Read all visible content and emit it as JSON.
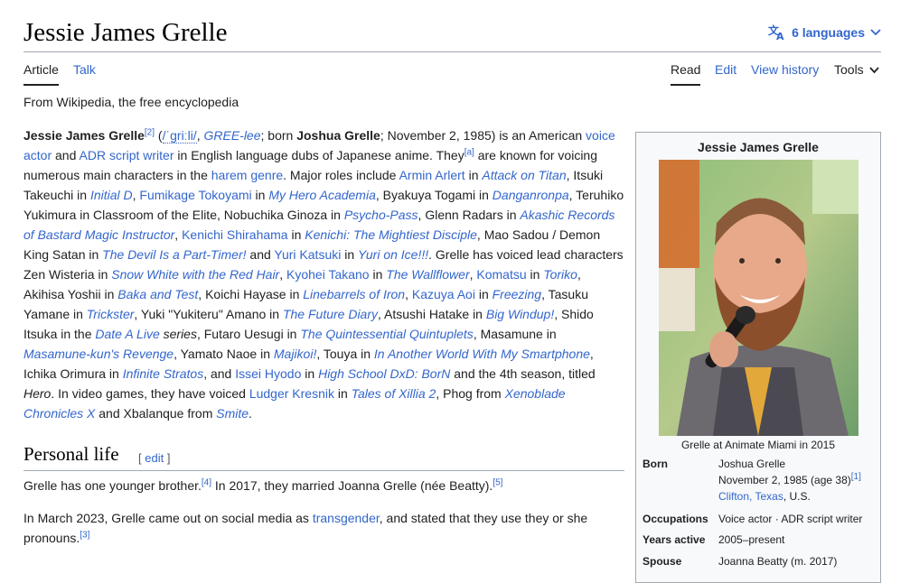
{
  "header": {
    "title": "Jessie James Grelle",
    "languages_label": "6 languages"
  },
  "tabs": {
    "article": "Article",
    "talk": "Talk",
    "read": "Read",
    "edit": "Edit",
    "view_history": "View history",
    "tools": "Tools"
  },
  "tagline": "From Wikipedia, the free encyclopedia",
  "intro": {
    "name_bold": "Jessie James Grelle",
    "ref_2": "[2]",
    "ipa": "/ˈɡriːli/",
    "respell": "GREE-lee",
    "born_text": "; born ",
    "birth_name": "Joshua Grelle",
    "after_birth": "; November 2, 1985) is an American ",
    "voice_actor": "voice actor",
    "and": " and ",
    "adr": "ADR script writer",
    "in_english": " in English language dubs of Japanese anime. They",
    "ref_a": "[a]",
    "known_for": " are known for voicing numerous main characters in the ",
    "harem": "harem genre",
    "major_roles": ". Major roles include ",
    "armin": "Armin Arlert",
    "in1": " in ",
    "aot": "Attack on Titan",
    "itsuki": ", Itsuki Takeuchi in ",
    "initial_d": "Initial D",
    "c1": ", ",
    "fumikage": "Fumikage Tokoyami",
    "in2": " in ",
    "mha": "My Hero Academia",
    "byakuya": ", Byakuya Togami in ",
    "danganronpa": "Danganronpa",
    "teruhiko": ", Teruhiko Yukimura in Classroom of the Elite, Nobuchika Ginoza in ",
    "psycho_pass": "Psycho-Pass",
    "glenn": ", Glenn Radars in ",
    "akashic": "Akashic Records of Bastard Magic Instructor",
    "c2": ", ",
    "kenichi": "Kenichi Shirahama",
    "in3": " in ",
    "kenichi_show": "Kenichi: The Mightiest Disciple",
    "mao": ", Mao Sadou / Demon King Satan in ",
    "devil": "The Devil Is a Part-Timer!",
    "and2": " and ",
    "yuri": "Yuri Katsuki",
    "in4": " in ",
    "yuri_show": "Yuri on Ice!!!",
    "lead": ". Grelle has voiced lead characters Zen Wisteria in ",
    "snow_white": "Snow White with the Red Hair",
    "c3": ", ",
    "kyohei": "Kyohei Takano",
    "in5": " in ",
    "wallflower": "The Wallflower",
    "c4": ", ",
    "komatsu": "Komatsu",
    "in6": " in ",
    "toriko": "Toriko",
    "akihisa": ", Akihisa Yoshii in ",
    "baka": "Baka and Test",
    "koichi": ", Koichi Hayase in ",
    "linebarrels": "Linebarrels of Iron",
    "c5": ", ",
    "kazuya": "Kazuya Aoi",
    "in7": " in ",
    "freezing": "Freezing",
    "tasuku": ", Tasuku Yamane in ",
    "trickster": "Trickster",
    "yukiteru": ", Yuki \"Yukiteru\" Amano in ",
    "future_diary": "The Future Diary",
    "atsushi": ", Atsushi Hatake in ",
    "big_windup": "Big Windup!",
    "shido": ", Shido Itsuka in the ",
    "date_a_live": "Date A Live",
    "series": " series",
    "futaro": ", Futaro Uesugi in ",
    "quint": "The Quintessential Quintuplets",
    "masamune_pre": ", Masamune in ",
    "masamune": "Masamune-kun's Revenge",
    "yamato": ", Yamato Naoe in ",
    "majikoi": "Majikoi!",
    "touya": ", Touya in ",
    "another_world": "In Another World With My Smartphone",
    "ichika": ", Ichika Orimura in ",
    "infinite": "Infinite Stratos",
    "and3": ", and ",
    "issei": "Issei Hyodo",
    "in8": " in ",
    "hsdxd": "High School DxD: BorN",
    "fourth": " and the 4th season, titled ",
    "hero": "Hero",
    "video_games": ". In video games, they have voiced ",
    "ludger": "Ludger Kresnik",
    "in9": " in ",
    "xillia": "Tales of Xillia 2",
    "phog": ", Phog from ",
    "xenoblade": "Xenoblade Chronicles X",
    "xbalanque": " and Xbalanque from ",
    "smite": "Smite",
    "end": "."
  },
  "personal_life": {
    "heading": "Personal life",
    "edit_open": "[ ",
    "edit_label": "edit",
    "edit_close": " ]",
    "p1_a": "Grelle has one younger brother.",
    "p1_ref4": "[4]",
    "p1_b": " In 2017, they married Joanna Grelle (née Beatty).",
    "p1_ref5": "[5]",
    "p2_a": "In March 2023, Grelle came out on social media as ",
    "p2_link": "transgender",
    "p2_b": ", and stated that they use they or she pronouns.",
    "p2_ref3": "[3]"
  },
  "infobox": {
    "title": "Jessie James Grelle",
    "caption": "Grelle at Animate Miami in 2015",
    "born_label": "Born",
    "born_name": "Joshua Grelle",
    "born_date": "November 2, 1985 (age 38)",
    "born_ref": "[1]",
    "born_city": "Clifton, Texas",
    "born_country": ", U.S.",
    "occupations_label": "Occupations",
    "occupations_value": "Voice actor · ADR script writer",
    "years_label": "Years active",
    "years_value": "2005–present",
    "spouse_label": "Spouse",
    "spouse_value": "Joanna Beatty (m. 2017)"
  }
}
